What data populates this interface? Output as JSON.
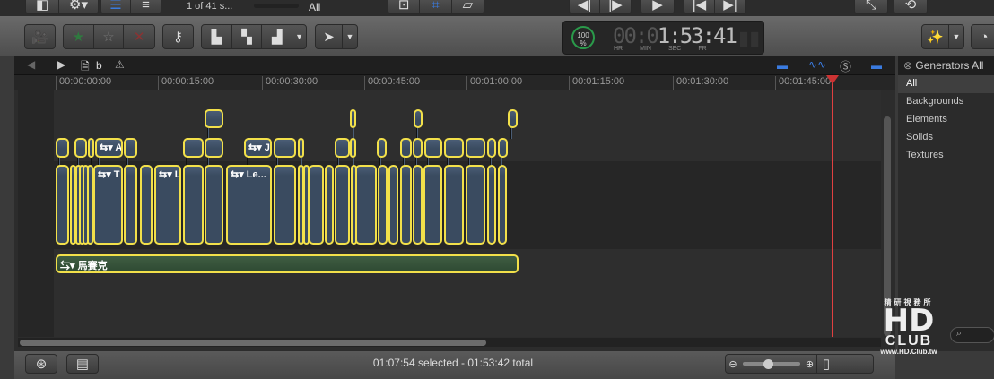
{
  "topbar": {
    "clip_count": "1 of 41 s...",
    "filter": "All"
  },
  "timecode": {
    "percent": "100",
    "percent_sign": "%",
    "dim": "00:0",
    "value": "1:53:41",
    "labels": [
      "HR",
      "MIN",
      "SEC",
      "FR"
    ]
  },
  "timeline": {
    "project_name": "b",
    "ruler": [
      "00:00:00:00",
      "00:00:15:00",
      "00:00:30:00",
      "00:00:45:00",
      "00:01:00:00",
      "00:01:15:00",
      "00:01:30:00",
      "00:01:45:00"
    ],
    "clip_labels": {
      "a": "A",
      "t": "T",
      "j": "J",
      "l": "L",
      "le": "Le...",
      "mosaic": "馬賽克"
    }
  },
  "status": {
    "text": "01:07:54 selected - 01:53:42 total"
  },
  "generators": {
    "title": "Generators",
    "items": [
      "All",
      "Backgrounds",
      "Elements",
      "Solids",
      "Textures"
    ],
    "selected": "All"
  },
  "watermark": {
    "cjk": "精研視務所",
    "brand": "HD CLUB",
    "url": "www.HD.Club.tw"
  },
  "colors": {
    "selection": "#f2e04a",
    "clip": "#3a4b60",
    "audio_clip": "#2f4a33",
    "playhead": "#e04040",
    "accent": "#3a7be0"
  }
}
